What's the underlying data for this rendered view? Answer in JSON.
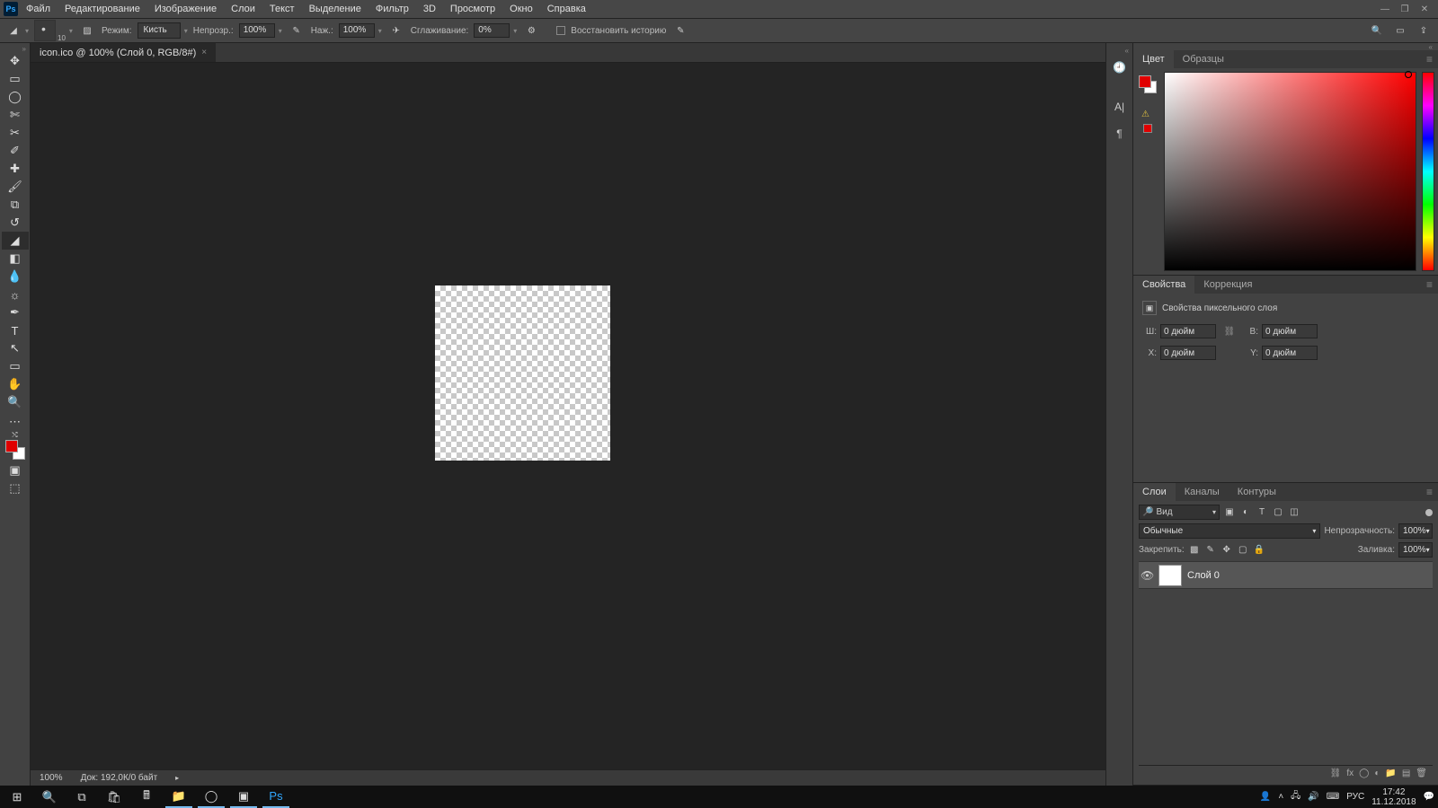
{
  "menu": {
    "items": [
      "Файл",
      "Редактирование",
      "Изображение",
      "Слои",
      "Текст",
      "Выделение",
      "Фильтр",
      "3D",
      "Просмотр",
      "Окно",
      "Справка"
    ]
  },
  "options": {
    "brush_size": "10",
    "mode_label": "Режим:",
    "mode_value": "Кисть",
    "opacity_label": "Непрозр.:",
    "opacity_value": "100%",
    "pressure_label": "Наж.:",
    "pressure_value": "100%",
    "smooth_label": "Сглаживание:",
    "smooth_value": "0%",
    "restore_label": "Восстановить историю"
  },
  "document": {
    "tab_title": "icon.ico @ 100% (Слой 0, RGB/8#)",
    "zoom_status": "100%",
    "doc_status": "Док: 192,0К/0 байт"
  },
  "panels": {
    "color": {
      "tabs": [
        "Цвет",
        "Образцы"
      ]
    },
    "properties": {
      "tabs": [
        "Свойства",
        "Коррекция"
      ],
      "title": "Свойства пиксельного слоя",
      "w_label": "Ш:",
      "w_value": "0 дюйм",
      "h_label": "В:",
      "h_value": "0 дюйм",
      "x_label": "X:",
      "x_value": "0 дюйм",
      "y_label": "Y:",
      "y_value": "0 дюйм"
    },
    "layers": {
      "tabs": [
        "Слои",
        "Каналы",
        "Контуры"
      ],
      "search": "Вид",
      "blend": "Обычные",
      "opacity_label": "Непрозрачность:",
      "opacity_value": "100%",
      "lock_label": "Закрепить:",
      "fill_label": "Заливка:",
      "fill_value": "100%",
      "layer0": "Слой 0"
    }
  },
  "taskbar": {
    "lang": "РУС",
    "time": "17:42",
    "date": "11.12.2018"
  }
}
